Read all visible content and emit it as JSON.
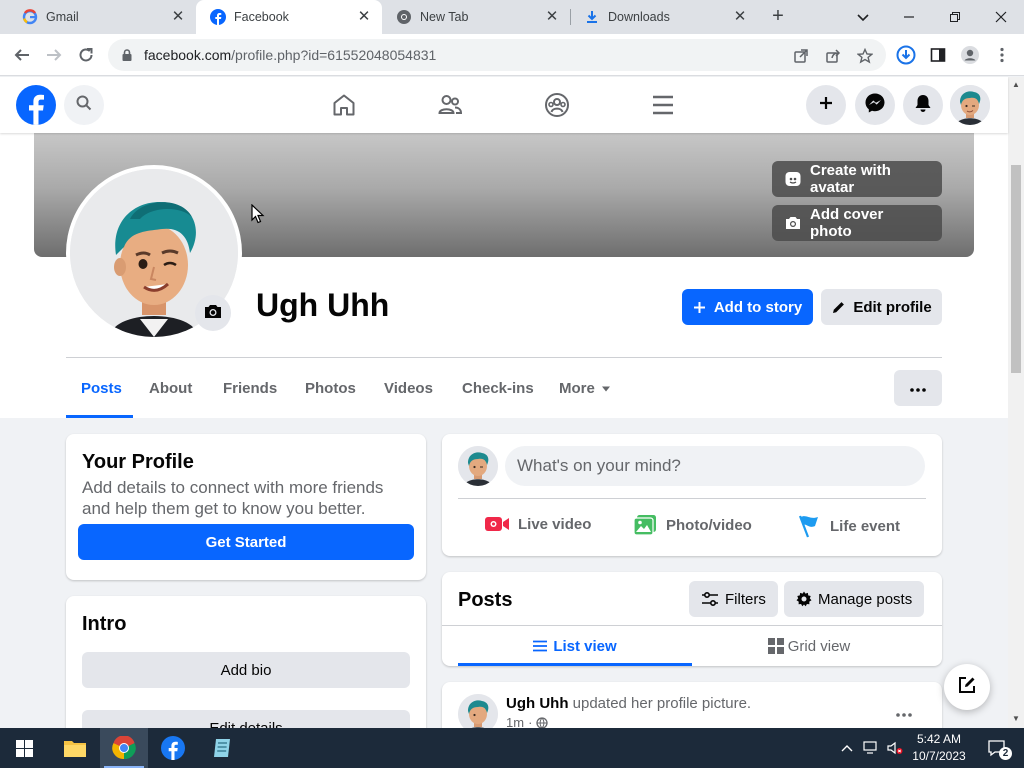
{
  "browser": {
    "tabs": [
      {
        "label": "Gmail",
        "active": false
      },
      {
        "label": "Facebook",
        "active": true
      },
      {
        "label": "New Tab",
        "active": false
      },
      {
        "label": "Downloads",
        "active": false
      }
    ],
    "url_host": "facebook.com",
    "url_path": "/profile.php?id=61552048054831"
  },
  "fb": {
    "cover_buttons": {
      "create_avatar": "Create with avatar",
      "add_cover": "Add cover photo"
    },
    "profile_name": "Ugh Uhh",
    "actions": {
      "add_story": "Add to story",
      "edit_profile": "Edit profile"
    },
    "tabs": [
      "Posts",
      "About",
      "Friends",
      "Photos",
      "Videos",
      "Check-ins",
      "More"
    ],
    "active_tab": "Posts",
    "your_profile": {
      "title": "Your Profile",
      "desc_line1": "Add details to connect with more friends",
      "desc_line2": "and help them get to know you better.",
      "button": "Get Started"
    },
    "intro": {
      "title": "Intro",
      "add_bio": "Add bio",
      "edit_details": "Edit details"
    },
    "composer": {
      "placeholder": "What's on your mind?",
      "live": "Live video",
      "photo": "Photo/video",
      "life": "Life event"
    },
    "posts": {
      "title": "Posts",
      "filters": "Filters",
      "manage": "Manage posts",
      "list_view": "List view",
      "grid_view": "Grid view"
    },
    "post": {
      "author": "Ugh Uhh",
      "action": "updated her profile picture.",
      "time": "1m"
    }
  },
  "taskbar": {
    "time": "5:42 AM",
    "date": "10/7/2023",
    "notification_count": "2"
  },
  "colors": {
    "fb_blue": "#0866ff",
    "text_primary": "#050505",
    "text_secondary": "#65676b",
    "button_gray": "#e4e6eb",
    "page_bg": "#f0f2f5"
  }
}
